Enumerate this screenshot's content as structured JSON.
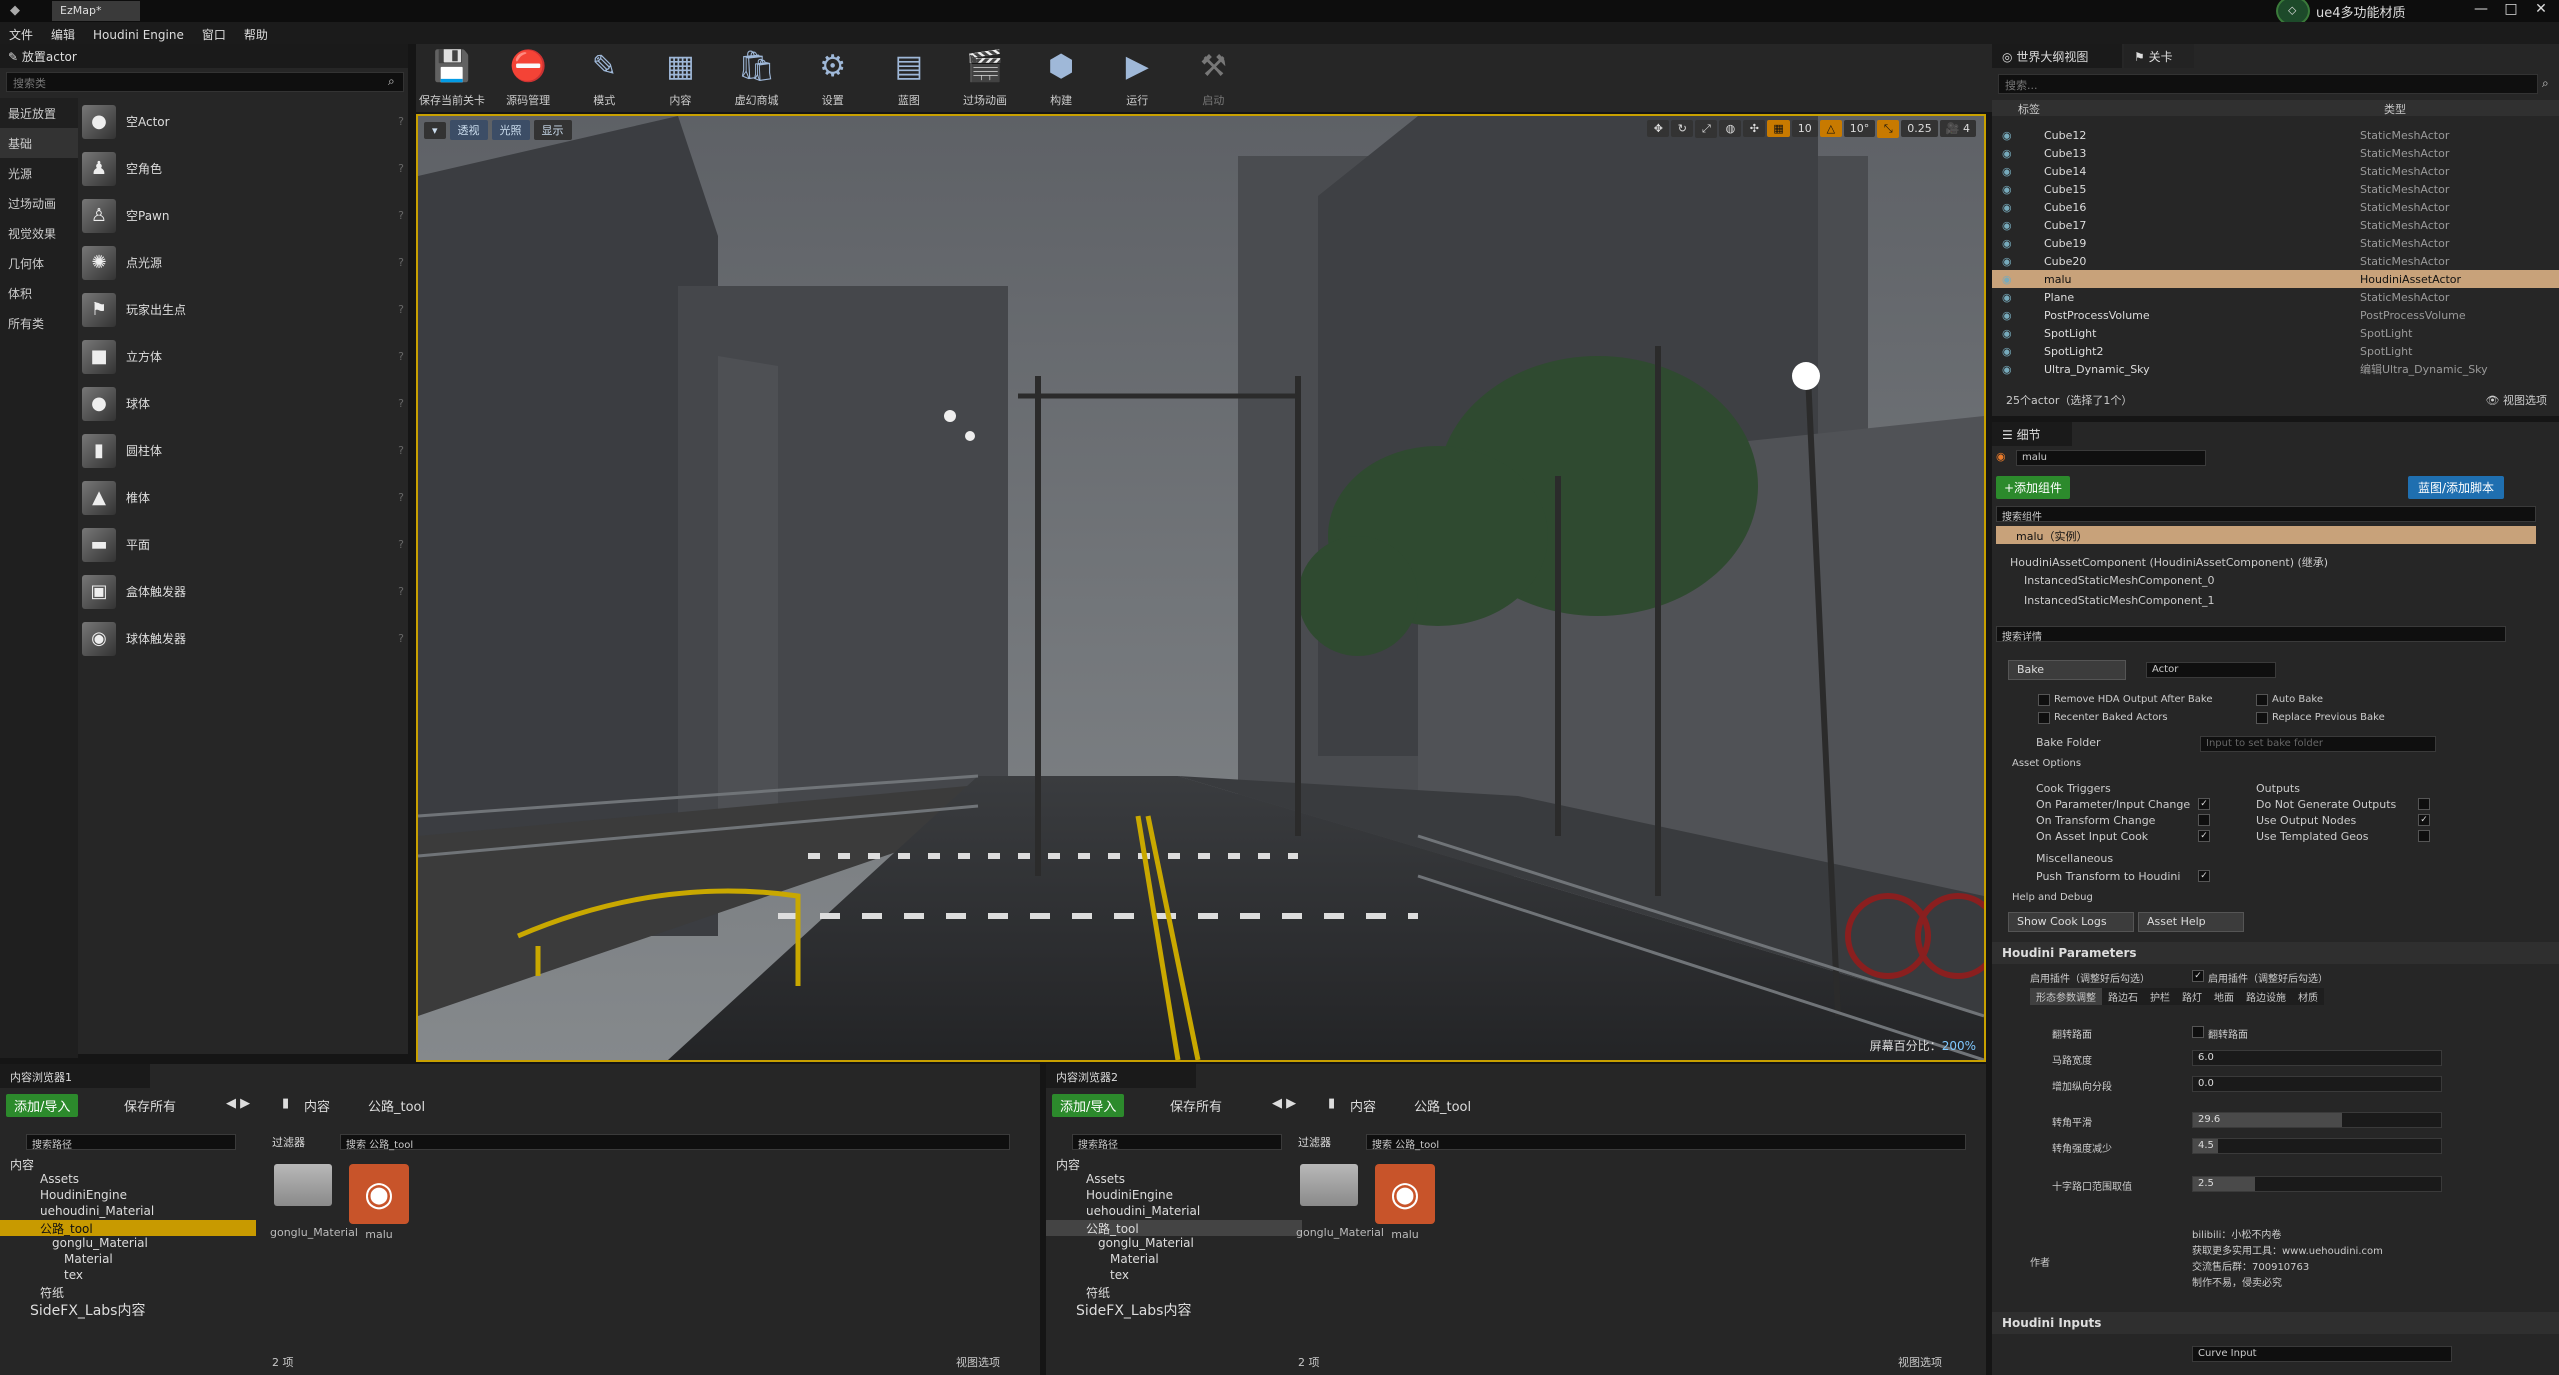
{
  "window": {
    "tab": "EzMap*",
    "title_right": "ue4多功能材质"
  },
  "menu": [
    "文件",
    "编辑",
    "Houdini Engine",
    "窗口",
    "帮助"
  ],
  "place_panel": {
    "title": "放置actor",
    "search_placeholder": "搜索类",
    "categories": [
      "最近放置",
      "基础",
      "光源",
      "过场动画",
      "视觉效果",
      "几何体",
      "体积",
      "所有类"
    ],
    "items": [
      "空Actor",
      "空角色",
      "空Pawn",
      "点光源",
      "玩家出生点",
      "立方体",
      "球体",
      "圆柱体",
      "椎体",
      "平面",
      "盒体触发器",
      "球体触发器"
    ]
  },
  "toolbar": [
    "保存当前关卡",
    "源码管理",
    "模式",
    "内容",
    "虚幻商城",
    "设置",
    "蓝图",
    "过场动画",
    "构建",
    "运行",
    "启动"
  ],
  "viewport": {
    "buttons": [
      "透视",
      "光照",
      "显示"
    ],
    "grid": "10",
    "rot": "10°",
    "scale_snap": "0.25",
    "cam_speed": "4",
    "screen_pct_label": "屏幕百分比：",
    "screen_pct": "200%"
  },
  "outliner": {
    "tab1": "世界大纲视图",
    "tab2": "关卡",
    "search_placeholder": "搜索...",
    "col_label": "标签",
    "col_type": "类型",
    "rows": [
      {
        "name": "Cube12",
        "type": "StaticMeshActor"
      },
      {
        "name": "Cube13",
        "type": "StaticMeshActor"
      },
      {
        "name": "Cube14",
        "type": "StaticMeshActor"
      },
      {
        "name": "Cube15",
        "type": "StaticMeshActor"
      },
      {
        "name": "Cube16",
        "type": "StaticMeshActor"
      },
      {
        "name": "Cube17",
        "type": "StaticMeshActor"
      },
      {
        "name": "Cube19",
        "type": "StaticMeshActor"
      },
      {
        "name": "Cube20",
        "type": "StaticMeshActor"
      },
      {
        "name": "malu",
        "type": "HoudiniAssetActor"
      },
      {
        "name": "Plane",
        "type": "StaticMeshActor"
      },
      {
        "name": "PostProcessVolume",
        "type": "PostProcessVolume"
      },
      {
        "name": "SpotLight",
        "type": "SpotLight"
      },
      {
        "name": "SpotLight2",
        "type": "SpotLight"
      },
      {
        "name": "Ultra_Dynamic_Sky",
        "type": "编辑Ultra_Dynamic_Sky"
      }
    ],
    "footer": "25个actor（选择了1个）",
    "view_options": "视图选项"
  },
  "details": {
    "tab": "细节",
    "name": "malu",
    "add_component": "+添加组件",
    "blueprint": "蓝图/添加脚本",
    "search_components": "搜索组件",
    "instance": "malu（实例）",
    "components": [
      "HoudiniAssetComponent (HoudiniAssetComponent) (继承)",
      "InstancedStaticMeshComponent_0",
      "InstancedStaticMeshComponent_1"
    ],
    "search_details": "搜索详情",
    "bake": "Bake",
    "bake_type": "Actor",
    "remove_hda": "Remove HDA Output After Bake",
    "auto_bake": "Auto Bake",
    "recenter": "Recenter Baked Actors",
    "replace_prev": "Replace Previous Bake",
    "bake_folder": "Bake Folder",
    "bake_folder_ph": "Input to set bake folder",
    "asset_options": "Asset Options",
    "cook_triggers": "Cook Triggers",
    "on_param": "On Parameter/Input Change",
    "on_transform": "On Transform Change",
    "on_asset": "On Asset Input Cook",
    "outputs": "Outputs",
    "no_gen": "Do Not Generate Outputs",
    "use_output": "Use Output Nodes",
    "use_templated": "Use Templated Geos",
    "misc": "Miscellaneous",
    "push": "Push Transform to Houdini",
    "help_debug": "Help and Debug",
    "cook_logs": "Show Cook Logs",
    "asset_help": "Asset Help",
    "hparams": "Houdini Parameters",
    "enable_plugin": "启用插件（调整好后勾选）",
    "subtabs": [
      "形态参数调整",
      "路边石",
      "护栏",
      "路灯",
      "地面",
      "路边设施",
      "材质"
    ],
    "params": [
      {
        "label": "翻转路面",
        "type": "check",
        "text": "翻转路面"
      },
      {
        "label": "马路宽度",
        "value": "6.0",
        "frac": 0.0
      },
      {
        "label": "增加纵向分段",
        "value": "0.0",
        "frac": 0.0
      },
      {
        "label": "转角平滑",
        "value": "29.6",
        "frac": 0.6
      },
      {
        "label": "转角强度减少",
        "value": "4.5",
        "frac": 0.1
      },
      {
        "label": "十字路口范围取值",
        "value": "2.5",
        "frac": 0.25
      }
    ],
    "author_label": "作者",
    "author_lines": [
      "bilibili：小松不内卷",
      "获取更多实用工具：www.uehoudini.com",
      "交流售后群：700910763",
      "制作不易，侵卖必究"
    ],
    "hinputs": "Houdini Inputs",
    "curve_input": "Curve Input"
  },
  "cb1": {
    "tab": "内容浏览器1",
    "add": "添加/导入",
    "save": "保存所有",
    "crumb1": "内容",
    "crumb2": "公路_tool",
    "search_path": "搜索路径",
    "filter": "过滤器",
    "search_assets": "搜索 公路_tool",
    "tree": [
      "内容",
      "Assets",
      "HoudiniEngine",
      "uehoudini_Material",
      "公路_tool",
      "gonglu_Material",
      "Material",
      "tex",
      "符纸",
      "SideFX_Labs内容"
    ],
    "asset1": "gonglu_Material",
    "asset2": "malu",
    "count": "2 项",
    "view_options": "视图选项"
  },
  "cb2": {
    "tab": "内容浏览器2",
    "add": "添加/导入",
    "save": "保存所有",
    "crumb1": "内容",
    "crumb2": "公路_tool",
    "search_path": "搜索路径",
    "filter": "过滤器",
    "search_assets": "搜索 公路_tool",
    "tree": [
      "内容",
      "Assets",
      "HoudiniEngine",
      "uehoudini_Material",
      "公路_tool",
      "gonglu_Material",
      "Material",
      "tex",
      "符纸",
      "SideFX_Labs内容"
    ],
    "asset1": "gonglu_Material",
    "asset2": "malu",
    "count": "2 项",
    "view_options": "视图选项"
  }
}
